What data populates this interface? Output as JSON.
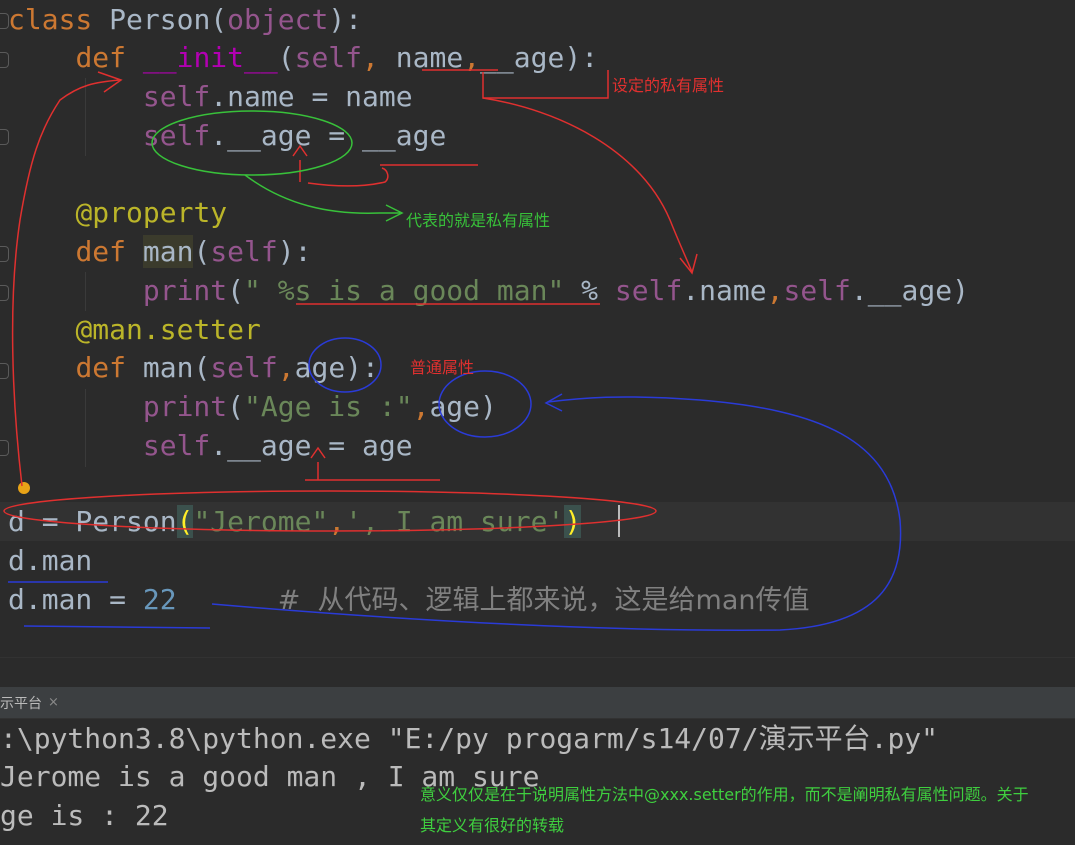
{
  "editor": {
    "lines": [
      {
        "parts": [
          {
            "t": "class ",
            "c": "kw"
          },
          {
            "t": "Person("
          },
          {
            "t": "object",
            "c": "self"
          },
          {
            "t": "):"
          }
        ]
      },
      {
        "parts": [
          {
            "t": "    "
          },
          {
            "t": "def ",
            "c": "kw"
          },
          {
            "t": "__init__",
            "c": "fn-magic"
          },
          {
            "t": "("
          },
          {
            "t": "self",
            "c": "self"
          },
          {
            "t": ", ",
            "c": "kw"
          },
          {
            "t": "name"
          },
          {
            "t": ",",
            "c": "kw"
          },
          {
            "t": "__age):"
          }
        ]
      },
      {
        "parts": [
          {
            "t": "        "
          },
          {
            "t": "self",
            "c": "self"
          },
          {
            "t": ".name = name"
          }
        ]
      },
      {
        "parts": [
          {
            "t": "        "
          },
          {
            "t": "self",
            "c": "self"
          },
          {
            "t": ".__age = __age"
          }
        ]
      },
      {
        "parts": [
          {
            "t": ""
          }
        ]
      },
      {
        "parts": [
          {
            "t": "    "
          },
          {
            "t": "@property",
            "c": "deco"
          }
        ]
      },
      {
        "parts": [
          {
            "t": "    "
          },
          {
            "t": "def ",
            "c": "kw"
          },
          {
            "t": "man",
            "c": "hl-man"
          },
          {
            "t": "("
          },
          {
            "t": "self",
            "c": "self"
          },
          {
            "t": "):"
          }
        ]
      },
      {
        "parts": [
          {
            "t": "        "
          },
          {
            "t": "print",
            "c": "self"
          },
          {
            "t": "("
          },
          {
            "t": "\" %s is a good man\"",
            "c": "str"
          },
          {
            "t": " % "
          },
          {
            "t": "self",
            "c": "self"
          },
          {
            "t": ".name"
          },
          {
            "t": ",",
            "c": "kw"
          },
          {
            "t": "self",
            "c": "self"
          },
          {
            "t": ".__age)"
          }
        ]
      },
      {
        "parts": [
          {
            "t": "    "
          },
          {
            "t": "@man.setter",
            "c": "deco"
          }
        ]
      },
      {
        "parts": [
          {
            "t": "    "
          },
          {
            "t": "def ",
            "c": "kw"
          },
          {
            "t": "man("
          },
          {
            "t": "self",
            "c": "self"
          },
          {
            "t": ",",
            "c": "kw"
          },
          {
            "t": "age):"
          }
        ]
      },
      {
        "parts": [
          {
            "t": "        "
          },
          {
            "t": "print",
            "c": "self"
          },
          {
            "t": "("
          },
          {
            "t": "\"Age is :\"",
            "c": "str"
          },
          {
            "t": ",",
            "c": "kw"
          },
          {
            "t": "age)"
          }
        ]
      },
      {
        "parts": [
          {
            "t": "        "
          },
          {
            "t": "self",
            "c": "self"
          },
          {
            "t": ".__age = age"
          }
        ]
      },
      {
        "parts": [
          {
            "t": ""
          }
        ]
      },
      {
        "parts": [
          {
            "t": "d = Person"
          },
          {
            "t": "(",
            "c": "paren-hl"
          },
          {
            "t": "\"Jerome\"",
            "c": "str"
          },
          {
            "t": ",",
            "c": "kw"
          },
          {
            "t": "', I am sure'",
            "c": "str"
          },
          {
            "t": ")",
            "c": "paren-hl"
          }
        ]
      },
      {
        "parts": [
          {
            "t": "d.man"
          }
        ]
      },
      {
        "parts": [
          {
            "t": "d.man = "
          },
          {
            "t": "22",
            "c": "num"
          },
          {
            "t": "      "
          },
          {
            "t": "#  从代码、逻辑上都来说，这是给man传值",
            "c": "cmt"
          }
        ]
      }
    ]
  },
  "annotations": {
    "private_attr_note": "设定的私有属性",
    "represents_private_note": "代表的就是私有属性",
    "normal_attr_note": "普通属性",
    "meaning_note": "意义仅仅是在于说明属性方法中@xxx.setter的作用，而不是阐明私有属性问题。关于其定义有很好的转载"
  },
  "run_panel": {
    "tab_label": "示平台",
    "close_glyph": "×"
  },
  "console": {
    "lines": [
      ":\\python3.8\\python.exe \"E:/py progarm/s14/07/演示平台.py\"",
      "Jerome is a good man , I am sure",
      "ge is : 22"
    ]
  },
  "colors": {
    "background": "#2b2b2b",
    "keyword": "#cc7832",
    "self": "#94558d",
    "string": "#6a8759",
    "number": "#6897bb",
    "decorator": "#bbb529",
    "annotation_red": "#e0302f",
    "annotation_green": "#38c13a",
    "annotation_blue": "#2a3bd8"
  }
}
